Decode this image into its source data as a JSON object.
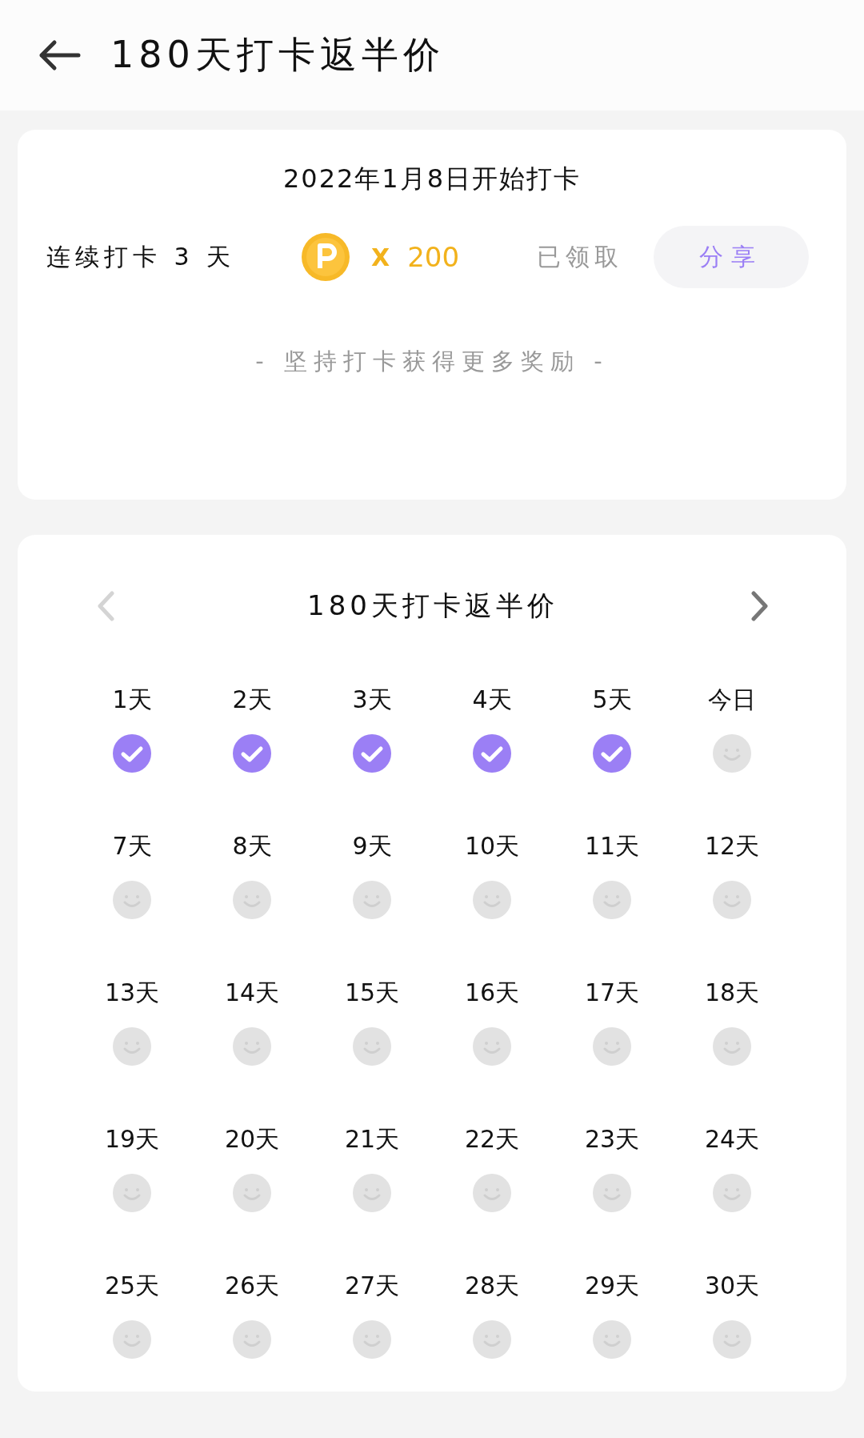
{
  "header": {
    "title": "180天打卡返半价"
  },
  "summary": {
    "start_text": "2022年1月8日开始打卡",
    "streak_text": "连续打卡 3 天",
    "multiplier": "X",
    "reward_amount": "200",
    "status": "已领取",
    "share_button": "分享",
    "encourage_text": "- 坚持打卡获得更多奖励 -"
  },
  "calendar": {
    "title": "180天打卡返半价",
    "prev_disabled": true,
    "next_disabled": false,
    "days": [
      {
        "label": "1天",
        "checked": true
      },
      {
        "label": "2天",
        "checked": true
      },
      {
        "label": "3天",
        "checked": true
      },
      {
        "label": "4天",
        "checked": true
      },
      {
        "label": "5天",
        "checked": true
      },
      {
        "label": "今日",
        "checked": false
      },
      {
        "label": "7天",
        "checked": false
      },
      {
        "label": "8天",
        "checked": false
      },
      {
        "label": "9天",
        "checked": false
      },
      {
        "label": "10天",
        "checked": false
      },
      {
        "label": "11天",
        "checked": false
      },
      {
        "label": "12天",
        "checked": false
      },
      {
        "label": "13天",
        "checked": false
      },
      {
        "label": "14天",
        "checked": false
      },
      {
        "label": "15天",
        "checked": false
      },
      {
        "label": "16天",
        "checked": false
      },
      {
        "label": "17天",
        "checked": false
      },
      {
        "label": "18天",
        "checked": false
      },
      {
        "label": "19天",
        "checked": false
      },
      {
        "label": "20天",
        "checked": false
      },
      {
        "label": "21天",
        "checked": false
      },
      {
        "label": "22天",
        "checked": false
      },
      {
        "label": "23天",
        "checked": false
      },
      {
        "label": "24天",
        "checked": false
      },
      {
        "label": "25天",
        "checked": false
      },
      {
        "label": "26天",
        "checked": false
      },
      {
        "label": "27天",
        "checked": false
      },
      {
        "label": "28天",
        "checked": false
      },
      {
        "label": "29天",
        "checked": false
      },
      {
        "label": "30天",
        "checked": false
      }
    ]
  }
}
